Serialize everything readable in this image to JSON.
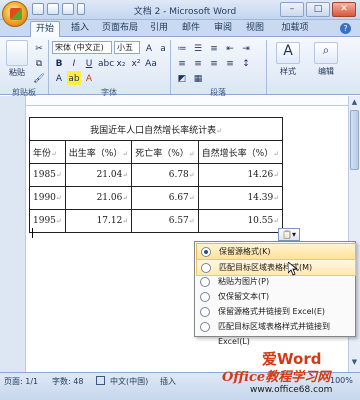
{
  "title_bar": {
    "document_title": "文档 2 - Microsoft Word",
    "minimize": "–",
    "restore": "□",
    "close": "✕"
  },
  "tabs": [
    "开始",
    "插入",
    "页面布局",
    "引用",
    "邮件",
    "审阅",
    "视图",
    "加载项"
  ],
  "ribbon": {
    "paste_label": "粘贴",
    "font_name": "宋体 (中文正)",
    "font_size": "小五",
    "bold": "B",
    "italic": "I",
    "underline": "U",
    "styles_label": "样式",
    "editing_label": "编辑",
    "groups": {
      "clipboard": "剪贴板",
      "font": "字体",
      "paragraph": "段落"
    }
  },
  "document": {
    "table_caption": "我国近年人口自然增长率统计表",
    "headers": [
      "年份",
      "出生率（%）",
      "死亡率（%）",
      "自然增长率（%）"
    ],
    "rows": [
      [
        "1985",
        "21.04",
        "6.78",
        "14.26"
      ],
      [
        "1990",
        "21.06",
        "6.67",
        "14.39"
      ],
      [
        "1995",
        "17.12",
        "6.57",
        "10.55"
      ]
    ]
  },
  "paste_options": {
    "items": [
      {
        "label": "保留源格式(K)",
        "selected": true
      },
      {
        "label": "匹配目标区域表格样式(M)",
        "selected": false
      },
      {
        "label": "粘贴为图片(P)",
        "selected": false
      },
      {
        "label": "仅保留文本(T)",
        "selected": false
      },
      {
        "label": "保留源格式并链接到 Excel(E)",
        "selected": false
      },
      {
        "label": "匹配目标区域表格样式并链接到 Excel(L)",
        "selected": false
      }
    ]
  },
  "status_bar": {
    "page": "页面: 1/1",
    "words": "字数: 48",
    "language": "中文(中国)",
    "insert_mode": "插入",
    "zoom": "100%"
  },
  "watermark": {
    "line1": "爱Word",
    "line2": "Office教程学习网",
    "line3": "www.office68.com"
  }
}
